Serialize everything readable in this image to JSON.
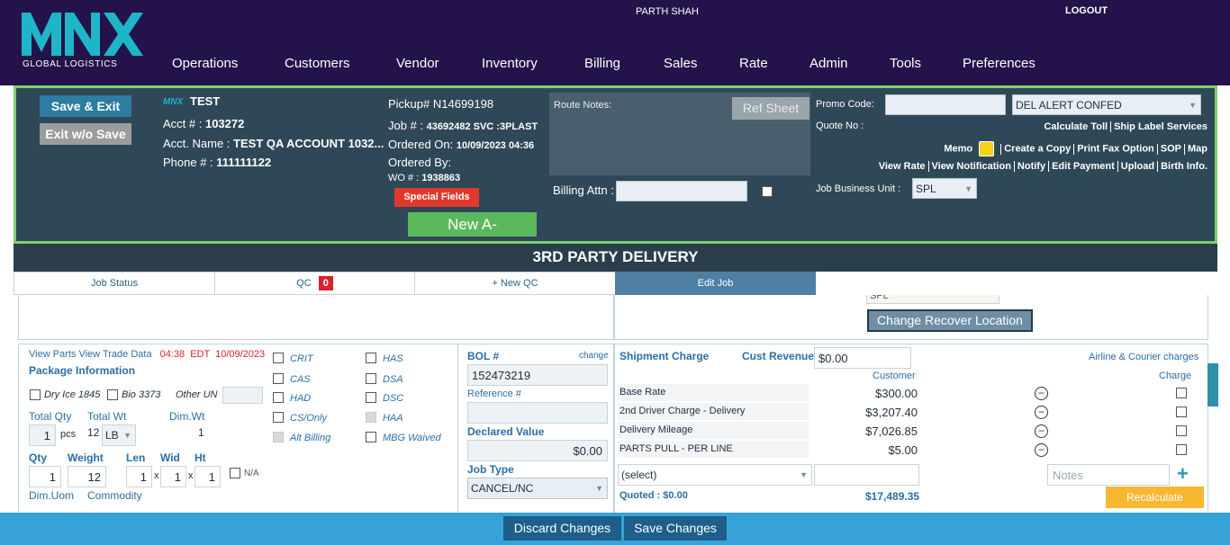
{
  "header": {
    "logo_text": "MNX",
    "logo_sub": "GLOBAL LOGISTICS",
    "user_name": "PARTH SHAH",
    "logout_label": "LOGOUT",
    "nav": [
      "Operations",
      "Customers",
      "Vendor",
      "Inventory",
      "Billing",
      "Sales",
      "Rate",
      "Admin",
      "Tools",
      "Preferences"
    ]
  },
  "job_panel": {
    "save_exit_label": "Save & Exit",
    "exit_nosave_label": "Exit w/o Save",
    "brand_small": "MNX",
    "account_title": "TEST",
    "acct_label": "Acct # : ",
    "acct_value": "103272",
    "acct_name_label": "Acct. Name : ",
    "acct_name_value": "TEST QA ACCOUNT 1032...",
    "phone_label": "Phone # : ",
    "phone_value": "111111122",
    "pickup_label": "Pickup# ",
    "pickup_value": "N14699198",
    "job_label": "Job # : ",
    "job_value": "43692482 SVC :3PLAST",
    "ordered_on_label": "Ordered On: ",
    "ordered_on_value": "10/09/2023 04:36",
    "ordered_by_label": "Ordered By:",
    "wo_label": "WO # : ",
    "wo_value": "1938863",
    "special_fields_label": "Special Fields",
    "new_a_label": "New A-",
    "route_notes_label": "Route Notes:",
    "ref_sheet_label": "Ref Sheet",
    "billing_attn_label": "Billing Attn :",
    "promo_code_label": "Promo Code:",
    "quote_no_label": "Quote No :",
    "del_alert_value": "DEL ALERT CONFED",
    "links_row1": [
      "Calculate Toll",
      "Ship Label Services"
    ],
    "memo_label": "Memo",
    "links_row2": [
      "Create a Copy",
      "Print Fax Option",
      "SOP",
      "Map"
    ],
    "links_row3": [
      "View Rate",
      "View Notification",
      "Notify",
      "Edit Payment",
      "Upload",
      "Birth Info."
    ],
    "job_bu_label": "Job Business Unit :",
    "job_bu_value": "SPL"
  },
  "title": "3RD PARTY DELIVERY",
  "tabs": [
    {
      "label": "Job Status"
    },
    {
      "label": "QC",
      "badge": "0"
    },
    {
      "label": "+ New QC"
    },
    {
      "label": "Edit Job"
    }
  ],
  "content": {
    "change_recover_label": "Change Recover Location",
    "partial_field_value": "SPL",
    "view_parts_label": "View Parts",
    "view_trade_label": "View Trade Data",
    "time_value": "04:38",
    "tz_value": "EDT",
    "date_value": "10/09/2023",
    "package_info_label": "Package Information",
    "dry_ice_label": "Dry Ice 1845",
    "bio_label": "Bio 3373",
    "other_un_label": "Other UN",
    "total_qty_label": "Total Qty",
    "total_wt_label": "Total Wt",
    "dim_wt_label": "Dim.Wt",
    "total_qty_value": "1",
    "pcs_label": "pcs",
    "total_wt_value": "12",
    "wt_unit": "LB",
    "dim_wt_value": "1",
    "qty_label": "Qty",
    "weight_label": "Weight",
    "len_label": "Len",
    "wid_label": "Wid",
    "ht_label": "Ht",
    "qty_value": "1",
    "weight_value": "12",
    "len_value": "1",
    "wid_value": "1",
    "ht_value": "1",
    "x_sep": "x",
    "na_label": "N/A",
    "dim_uom_label": "Dim.Uom",
    "commodity_label": "Commodity",
    "flags_left": [
      "CRIT",
      "CAS",
      "HAD",
      "CS/Only",
      "Alt Billing"
    ],
    "flags_right": [
      "HAS",
      "DSA",
      "DSC",
      "HAA",
      "MBG Waived"
    ],
    "bol_label": "BOL #",
    "change_label": "change",
    "bol_value": "152473219",
    "reference_label": "Reference #",
    "declared_label": "Declared Value",
    "declared_value": "$0.00",
    "job_type_label": "Job Type",
    "job_type_value": "CANCEL/NC",
    "shipment_charge_label": "Shipment Charge",
    "cust_revenue_label": "Cust Revenue",
    "cust_revenue_value": "$0.00",
    "airline_label": "Airline & Courier charges",
    "customer_col_label": "Customer",
    "charge_col_label": "Charge",
    "charges": [
      {
        "name": "Base Rate",
        "amount": "$300.00"
      },
      {
        "name": "2nd Driver Charge - Delivery",
        "amount": "$3,207.40"
      },
      {
        "name": "Delivery Mileage",
        "amount": "$7,026.85"
      },
      {
        "name": "PARTS PULL - PER LINE",
        "amount": "$5.00"
      }
    ],
    "select_placeholder": "(select)",
    "notes_placeholder": "Notes",
    "plus_label": "+",
    "quoted_label": "Quoted : ",
    "quoted_value": "$0.00",
    "total_value": "$17,489.35",
    "recalculate_label": "Recalculate"
  },
  "footer": {
    "discard_label": "Discard Changes",
    "save_label": "Save Changes"
  },
  "colors": {
    "topbar": "#23134a",
    "panel": "#2f4858",
    "accent_green": "#7bd16b",
    "footer": "#37a2d7"
  }
}
